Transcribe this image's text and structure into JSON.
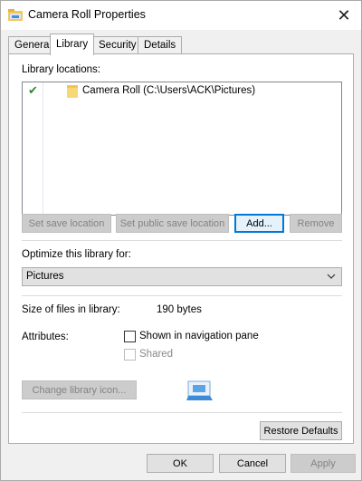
{
  "window": {
    "title": "Camera Roll Properties",
    "close_glyph": "✕"
  },
  "tabs": [
    {
      "label": "General",
      "active": false
    },
    {
      "label": "Library",
      "active": true
    },
    {
      "label": "Security",
      "active": false
    },
    {
      "label": "Details",
      "active": false
    }
  ],
  "library": {
    "locations_label": "Library locations:",
    "locations": [
      {
        "checked_glyph": "✔",
        "icon": "folder-icon",
        "label": "Camera Roll (C:\\Users\\ACK\\Pictures)"
      }
    ],
    "buttons": {
      "set_save": "Set save location",
      "set_public_save": "Set public save location",
      "add": "Add...",
      "remove": "Remove"
    },
    "optimize_label": "Optimize this library for:",
    "optimize_value": "Pictures",
    "size_label": "Size of files in library:",
    "size_value": "190 bytes",
    "attributes_label": "Attributes:",
    "shown_in_nav_label": "Shown in navigation pane",
    "shown_in_nav_checked": false,
    "shared_label": "Shared",
    "shared_checked": false,
    "change_icon_button": "Change library icon...",
    "restore_defaults_button": "Restore Defaults"
  },
  "footer": {
    "ok": "OK",
    "cancel": "Cancel",
    "apply": "Apply"
  },
  "colors": {
    "accent": "#0078d7",
    "check": "#2d8a2d",
    "folder": "#f8d775"
  }
}
